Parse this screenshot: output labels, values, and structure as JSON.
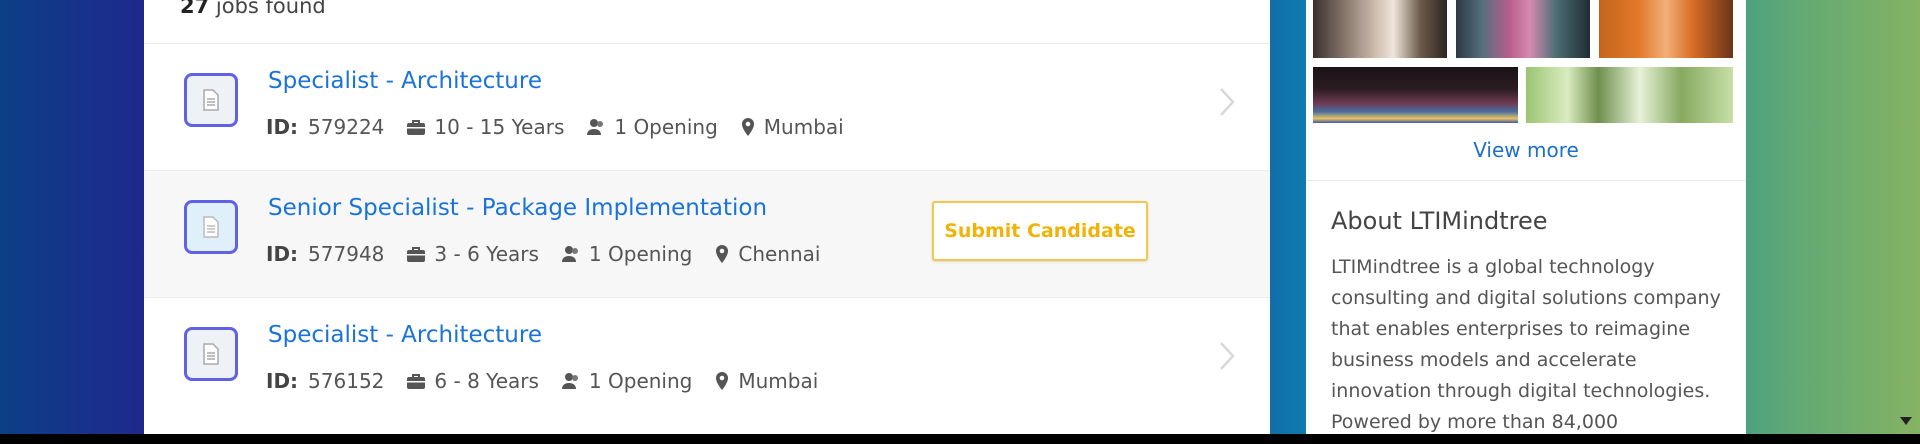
{
  "jobs_found": {
    "count": "27",
    "label": " jobs found"
  },
  "jobs": [
    {
      "title": "Specialist - Architecture",
      "id_label": "ID:",
      "id": "579224",
      "experience": "10 - 15 Years",
      "openings": "1 Opening",
      "location": "Mumbai"
    },
    {
      "title": "Senior Specialist - Package Implementation",
      "id_label": "ID:",
      "id": "577948",
      "experience": "3 - 6 Years",
      "openings": "1 Opening",
      "location": "Chennai",
      "action_label": "Submit Candidate"
    },
    {
      "title": "Specialist - Architecture",
      "id_label": "ID:",
      "id": "576152",
      "experience": "6 - 8 Years",
      "openings": "1 Opening",
      "location": "Mumbai"
    }
  ],
  "sidebar": {
    "view_more": "View more",
    "about_title": "About LTIMindtree",
    "about_text": "LTIMindtree is a global technology consulting and digital solutions company that enables enterprises to reimagine business models and accelerate innovation through digital technologies. Powered by more than 84,000"
  },
  "icons": {
    "job": "document-icon",
    "experience": "briefcase-icon",
    "openings": "people-icon",
    "location": "map-pin-icon",
    "row_action": "chevron-right-icon"
  },
  "colors": {
    "link": "#1a73d8",
    "accent_button": "#f0b30a",
    "icon_border": "#6161e4"
  }
}
